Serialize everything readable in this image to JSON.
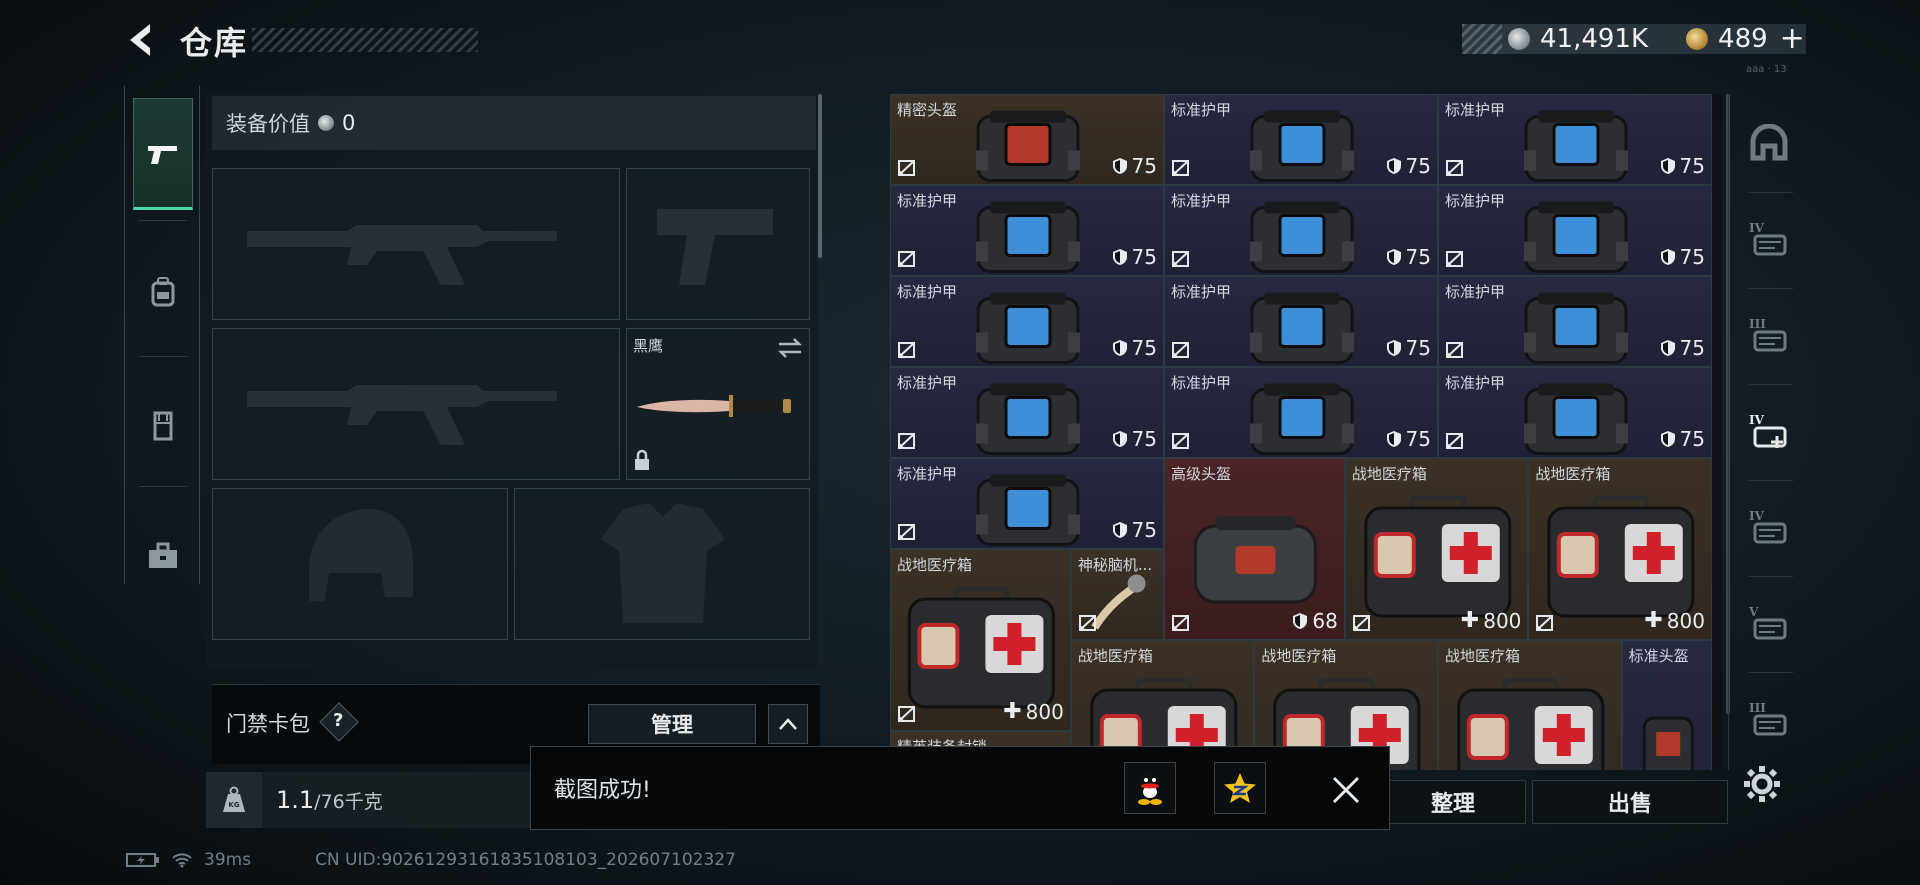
{
  "header": {
    "title": "仓库",
    "currency_silver": "41,491K",
    "currency_gold": "489",
    "gold_add_glyph": "+",
    "version": "aaa · 13"
  },
  "left_tabs": [
    {
      "icon": "pistol-icon",
      "active": true
    },
    {
      "icon": "backpack-icon",
      "active": false
    },
    {
      "icon": "chest-rig-icon",
      "active": false
    },
    {
      "icon": "toolbox-icon",
      "active": false
    }
  ],
  "equipment": {
    "value_label": "装备价值",
    "value": "0",
    "knife_slot_name": "黑鹰",
    "card_pack_label": "门禁卡包",
    "help_glyph": "?",
    "manage_label": "管理",
    "weight_current": "1.1",
    "weight_max": "/76千克"
  },
  "inventory": {
    "items": [
      {
        "name": "精密头盔",
        "type": "helmet",
        "durability": "75",
        "bg": "brown"
      },
      {
        "name": "标准护甲",
        "type": "armor",
        "durability": "75",
        "bg": "blue"
      },
      {
        "name": "标准护甲",
        "type": "armor",
        "durability": "75",
        "bg": "blue"
      },
      {
        "name": "标准护甲",
        "type": "armor",
        "durability": "75",
        "bg": "blue"
      },
      {
        "name": "标准护甲",
        "type": "armor",
        "durability": "75",
        "bg": "blue"
      },
      {
        "name": "标准护甲",
        "type": "armor",
        "durability": "75",
        "bg": "blue"
      },
      {
        "name": "标准护甲",
        "type": "armor",
        "durability": "75",
        "bg": "blue"
      },
      {
        "name": "标准护甲",
        "type": "armor",
        "durability": "75",
        "bg": "blue"
      },
      {
        "name": "标准护甲",
        "type": "armor",
        "durability": "75",
        "bg": "blue"
      },
      {
        "name": "标准护甲",
        "type": "armor",
        "durability": "75",
        "bg": "blue"
      },
      {
        "name": "标准护甲",
        "type": "armor",
        "durability": "75",
        "bg": "blue"
      },
      {
        "name": "标准护甲",
        "type": "armor",
        "durability": "75",
        "bg": "blue"
      },
      {
        "name": "标准护甲",
        "type": "armor",
        "durability": "75",
        "bg": "blue"
      },
      {
        "name": "高级头盔",
        "type": "helmet-big",
        "durability": "68",
        "bg": "red"
      },
      {
        "name": "战地医疗箱",
        "type": "medkit",
        "durability": "+800",
        "bg": "brown"
      },
      {
        "name": "战地医疗箱",
        "type": "medkit",
        "durability": "+800",
        "bg": "brown"
      },
      {
        "name": "战地医疗箱",
        "type": "medkit",
        "durability": "+800",
        "bg": "brown"
      },
      {
        "name": "神秘脑机...",
        "type": "chip",
        "durability": "",
        "bg": "brown"
      },
      {
        "name": "战地医疗箱",
        "type": "medkit",
        "durability": "",
        "bg": "brown"
      },
      {
        "name": "战地医疗箱",
        "type": "medkit",
        "durability": "",
        "bg": "brown"
      },
      {
        "name": "战地医疗箱",
        "type": "medkit",
        "durability": "",
        "bg": "brown"
      },
      {
        "name": "标准头盔",
        "type": "helmet-small",
        "durability": "",
        "bg": "blue"
      },
      {
        "name": "精英装备封锁...",
        "type": "cut",
        "durability": "",
        "bg": "brown"
      }
    ]
  },
  "filters": [
    {
      "icon": "helmet-filter-icon",
      "label": ""
    },
    {
      "icon": "armor-iv-filter-icon",
      "label": "IV"
    },
    {
      "icon": "armor-iii-filter-icon",
      "label": "III"
    },
    {
      "icon": "medkit-iv-filter-icon",
      "label": "IV"
    },
    {
      "icon": "vest-iv-filter-icon",
      "label": "IV"
    },
    {
      "icon": "vest-v-filter-icon",
      "label": "V"
    },
    {
      "icon": "gun-iii-filter-icon",
      "label": "III"
    }
  ],
  "actions": {
    "sort_label": "整理",
    "sell_label": "出售"
  },
  "toast": {
    "message": "截图成功!"
  },
  "status": {
    "ping": "39ms",
    "uid": "CN UID:9026129316183510​8103_202607102327"
  },
  "colors": {
    "accent_green": "#4cd9a0",
    "item_blue": "#26293f",
    "item_brown": "#3b3126",
    "item_red": "#4a2426"
  }
}
